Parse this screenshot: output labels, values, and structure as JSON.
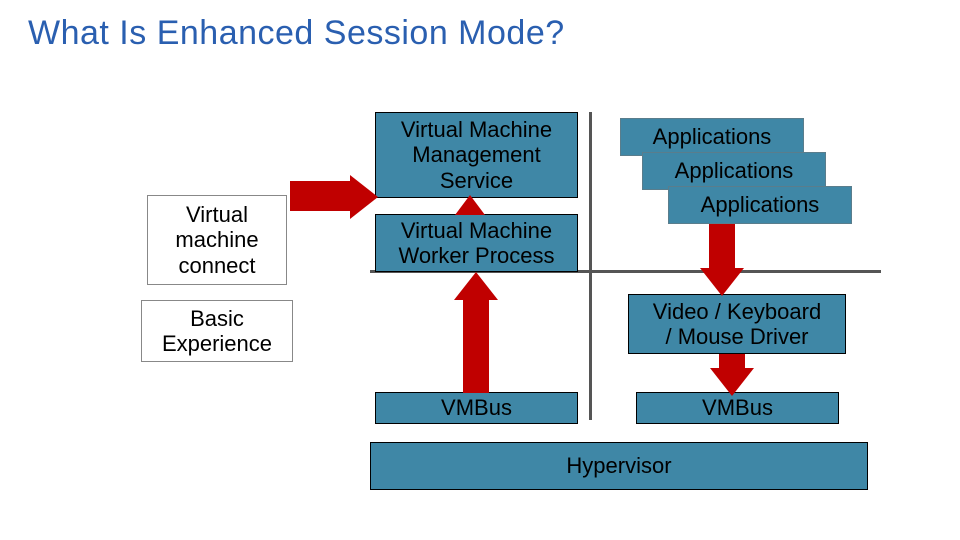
{
  "title": "What Is Enhanced Session Mode?",
  "boxes": {
    "vm_connect": "Virtual\nmachine\nconnect",
    "basic_experience": "Basic\nExperience",
    "vm_mgmt_service": "Virtual Machine\nManagement\nService",
    "vm_worker_process": "Virtual Machine\nWorker Process",
    "vmbus_left": "VMBus",
    "applications1": "Applications",
    "applications2": "Applications",
    "applications3": "Applications",
    "vkm_driver": "Video / Keyboard\n/ Mouse Driver",
    "vmbus_right": "VMBus",
    "hypervisor": "Hypervisor"
  }
}
